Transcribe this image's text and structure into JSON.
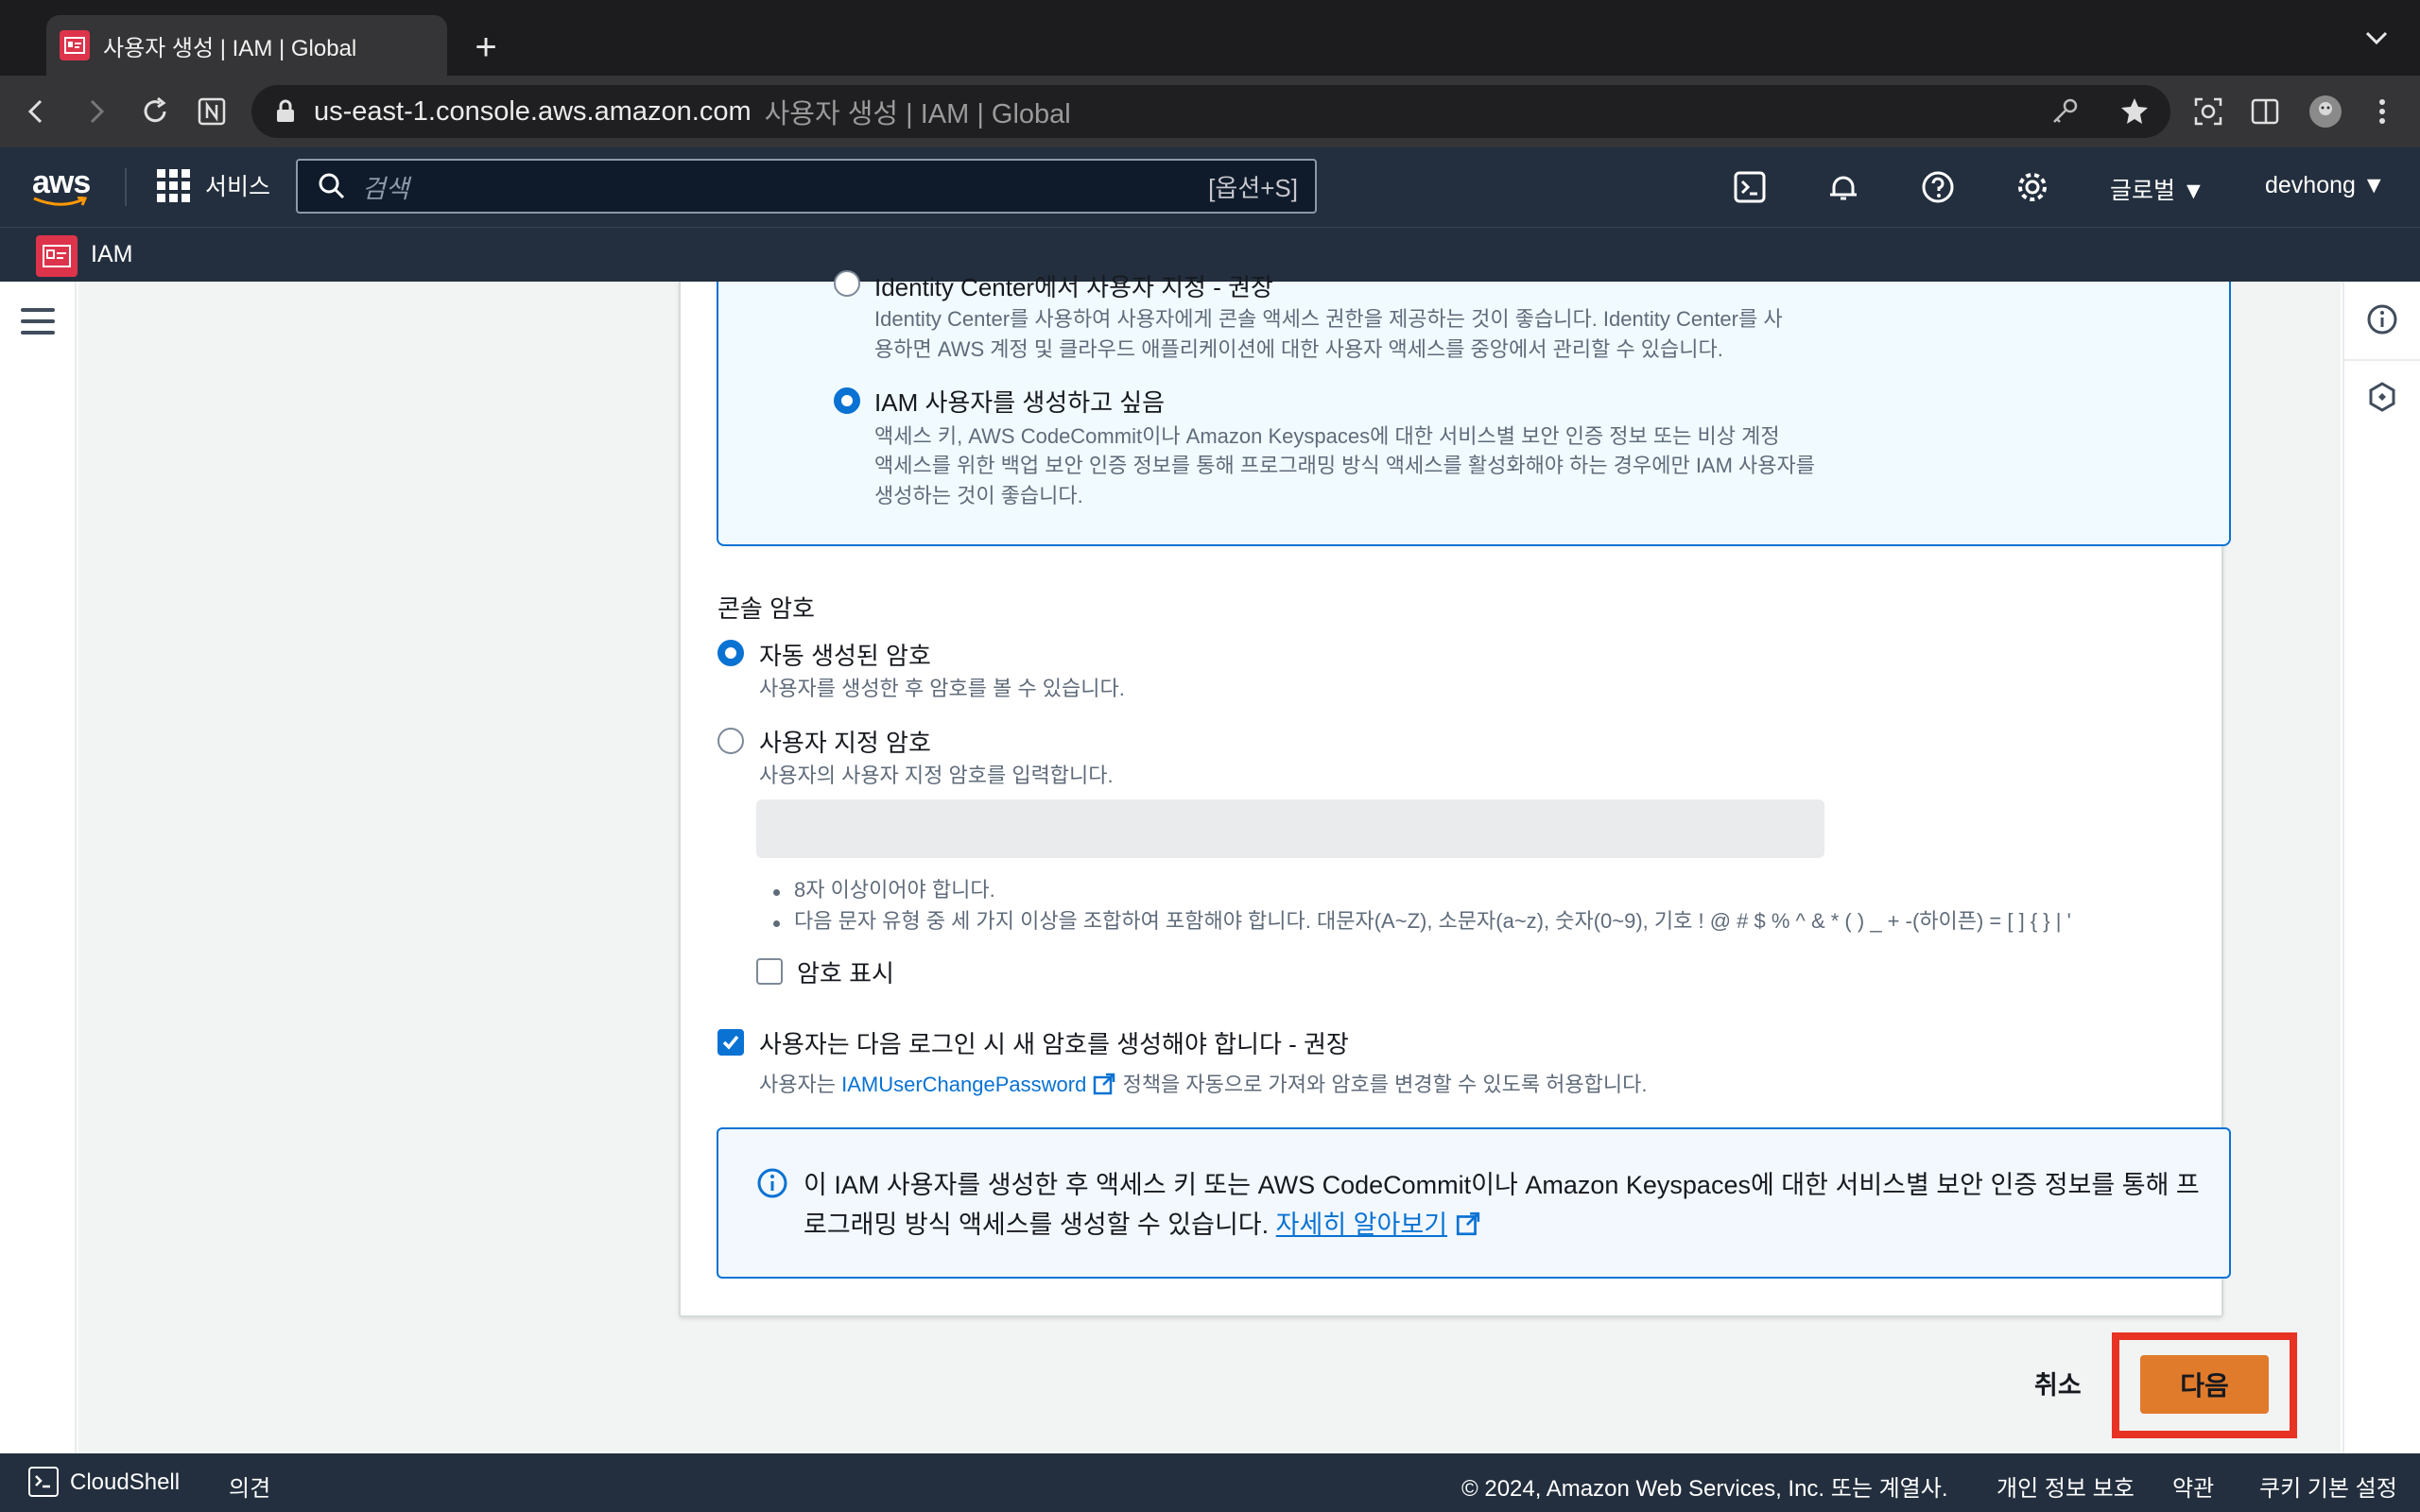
{
  "browser": {
    "tab_title": "사용자 생성 | IAM | Global",
    "url_host": "us-east-1.console.aws.amazon.com",
    "url_page_title": "사용자 생성 | IAM | Global"
  },
  "aws_nav": {
    "logo": "aws",
    "services_label": "서비스",
    "search_placeholder": "검색",
    "search_shortcut": "[옵션+S]",
    "region": "글로벌 ▼",
    "user": "devhong ▼"
  },
  "service_bar": {
    "service_name": "IAM"
  },
  "access_options": {
    "option1_label": "Identity Center에서 사용자 지정 - 권장",
    "option1_desc_line1": "Identity Center를 사용하여 사용자에게 콘솔 액세스 권한을 제공하는 것이 좋습니다. Identity Center를 사",
    "option1_desc_line2": "용하면 AWS 계정 및 클라우드 애플리케이션에 대한 사용자 액세스를 중앙에서 관리할 수 있습니다.",
    "option2_label": "IAM 사용자를 생성하고 싶음",
    "option2_desc_line1": "액세스 키, AWS CodeCommit이나 Amazon Keyspaces에 대한 서비스별 보안 인증 정보 또는 비상 계정",
    "option2_desc_line2": "액세스를 위한 백업 보안 인증 정보를 통해 프로그래밍 방식 액세스를 활성화해야 하는 경우에만 IAM 사용자를",
    "option2_desc_line3": "생성하는 것이 좋습니다."
  },
  "console_password": {
    "heading": "콘솔 암호",
    "auto_label": "자동 생성된 암호",
    "auto_desc": "사용자를 생성한 후 암호를 볼 수 있습니다.",
    "custom_label": "사용자 지정 암호",
    "custom_desc": "사용자의 사용자 지정 암호를 입력합니다.",
    "password_value": "",
    "rule1": "8자 이상이어야 합니다.",
    "rule2": "다음 문자 유형 중 세 가지 이상을 조합하여 포함해야 합니다. 대문자(A~Z), 소문자(a~z), 숫자(0~9), 기호 ! @ # $ % ^ & * ( ) _ + -(하이픈) = [ ] { } | '",
    "show_password_label": "암호 표시",
    "reset_label": "사용자는 다음 로그인 시 새 암호를 생성해야 합니다 - 권장",
    "reset_desc_prefix": "사용자는",
    "reset_desc_link": "IAMUserChangePassword",
    "reset_desc_suffix": "정책을 자동으로 가져와 암호를 변경할 수 있도록 허용합니다."
  },
  "info_alert": {
    "text": "이 IAM 사용자를 생성한 후 액세스 키 또는 AWS CodeCommit이나 Amazon Keyspaces에 대한 서비스별 보안 인증 정보를 통해 프로그래밍 방식 액세스를 생성할 수 있습니다.",
    "link": "자세히 알아보기"
  },
  "actions": {
    "cancel": "취소",
    "next": "다음"
  },
  "footer": {
    "cloudshell": "CloudShell",
    "feedback": "의견",
    "copyright": "© 2024, Amazon Web Services, Inc. 또는 계열사.",
    "privacy": "개인 정보 보호",
    "terms": "약관",
    "cookies": "쿠키 기본 설정"
  },
  "colors": {
    "aws_nav_bg": "#232f3e",
    "accent_blue": "#0972d3",
    "primary_orange": "#e07b2c",
    "highlight_red": "#e83224"
  }
}
